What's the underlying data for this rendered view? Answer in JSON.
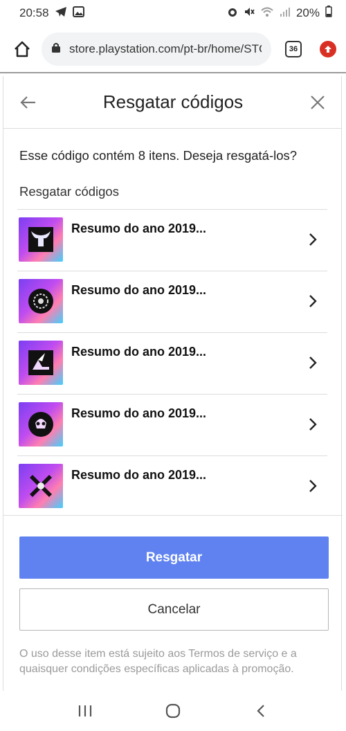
{
  "status_bar": {
    "time": "20:58",
    "battery": "20%",
    "left_icons": [
      "telegram-icon",
      "gallery-icon"
    ],
    "right_icons": [
      "alarm-icon",
      "mute-icon",
      "wifi-icon",
      "signal-icon",
      "battery-icon"
    ]
  },
  "browser": {
    "url": "store.playstation.com/pt-br/home/STC",
    "tab_count": "36",
    "home_icon": "home-icon",
    "lock_icon": "lock-icon",
    "update_icon": "update-icon"
  },
  "modal": {
    "title": "Resgatar códigos",
    "back_icon": "back-arrow-icon",
    "close_icon": "close-icon",
    "intro": "Esse código contém 8 itens. Deseja resgatá-los?",
    "section_label": "Resgatar códigos",
    "items": [
      {
        "name": "Resumo do ano 2019...",
        "icon": "horned-helmet-avatar-icon"
      },
      {
        "name": "Resumo do ano 2019...",
        "icon": "disc-avatar-icon"
      },
      {
        "name": "Resumo do ano 2019...",
        "icon": "winged-shoe-avatar-icon"
      },
      {
        "name": "Resumo do ano 2019...",
        "icon": "skull-avatar-icon"
      },
      {
        "name": "Resumo do ano 2019...",
        "icon": "cross-skull-avatar-icon"
      }
    ],
    "redeem_label": "Resgatar",
    "cancel_label": "Cancelar",
    "terms": "O uso desse item está sujeito aos Termos de serviço e a quaisquer condições específicas aplicadas à promoção."
  },
  "nav": {
    "icons": [
      "recents-icon",
      "home-circle-icon",
      "back-chevron-icon"
    ]
  },
  "colors": {
    "primary_button": "#5f82f0",
    "update_badge": "#d93025",
    "divider": "#dcdcdc"
  }
}
